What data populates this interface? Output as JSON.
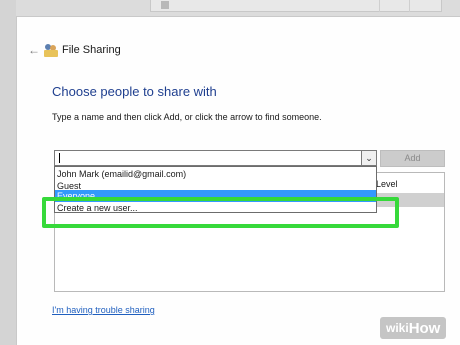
{
  "dialog": {
    "title": "File Sharing",
    "back_arrow": "←",
    "heading": "Choose people to share with",
    "instruction": "Type a name and then click Add, or click the arrow to find someone."
  },
  "combo": {
    "value": "",
    "arrow": "⌄"
  },
  "add_button": {
    "label": "Add"
  },
  "dropdown": {
    "items": [
      {
        "label": "John Mark (emailid@gmail.com)"
      },
      {
        "label": "Guest"
      },
      {
        "label": "Everyone"
      },
      {
        "label": "Create a new user..."
      }
    ],
    "selected": "Everyone"
  },
  "permissions": {
    "header_partial": "Level"
  },
  "trouble_link": {
    "label": "I'm having trouble sharing"
  },
  "watermark": {
    "wiki": "wiki",
    "how": "How"
  },
  "colors": {
    "highlight_green": "#36d93a",
    "selection_blue": "#3399ff",
    "heading_blue": "#1f3f8f",
    "link_blue": "#1f5fbf"
  }
}
